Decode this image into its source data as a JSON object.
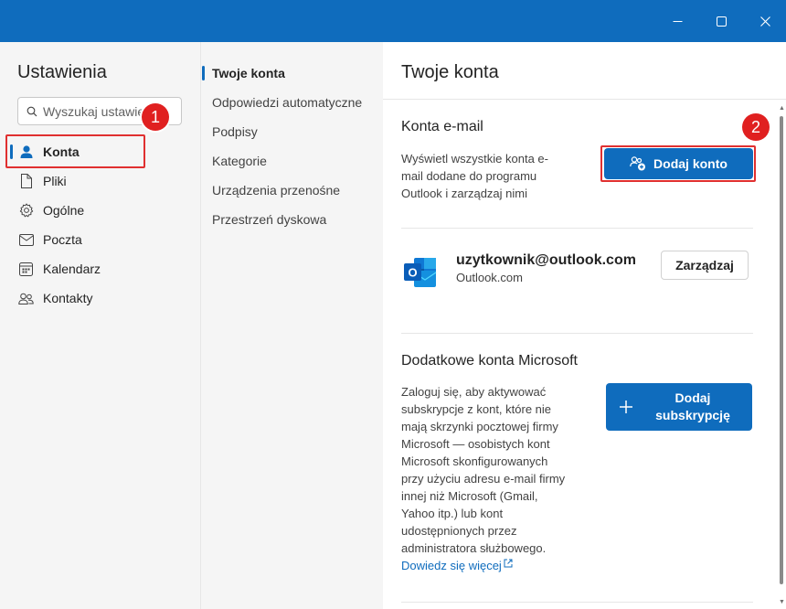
{
  "window": {
    "controls": {
      "minimize_icon": "minimize-icon",
      "maximize_icon": "maximize-icon",
      "close_icon": "close-icon"
    },
    "accent_color": "#0f6cbd"
  },
  "sidebar": {
    "title": "Ustawienia",
    "search": {
      "placeholder": "Wyszukaj ustawienia",
      "value": ""
    },
    "items": [
      {
        "label": "Konta",
        "icon": "person-icon",
        "active": true
      },
      {
        "label": "Pliki",
        "icon": "file-icon"
      },
      {
        "label": "Ogólne",
        "icon": "gear-icon"
      },
      {
        "label": "Poczta",
        "icon": "mail-icon"
      },
      {
        "label": "Kalendarz",
        "icon": "calendar-icon"
      },
      {
        "label": "Kontakty",
        "icon": "people-icon"
      }
    ]
  },
  "subnav": {
    "items": [
      {
        "label": "Twoje konta",
        "active": true
      },
      {
        "label": "Odpowiedzi automatyczne"
      },
      {
        "label": "Podpisy"
      },
      {
        "label": "Kategorie"
      },
      {
        "label": "Urządzenia przenośne"
      },
      {
        "label": "Przestrzeń dyskowa"
      }
    ]
  },
  "main": {
    "title": "Twoje konta",
    "email_section": {
      "title": "Konta e-mail",
      "description_lines": [
        "Wyświetl wszystkie konta e-",
        "mail dodane do programu",
        "Outlook i zarządzaj nimi"
      ],
      "add_button": "Dodaj konto"
    },
    "account": {
      "email": "uzytkownik@outlook.com",
      "type": "Outlook.com",
      "manage_button": "Zarządzaj"
    },
    "microsoft_section": {
      "title": "Dodatkowe konta Microsoft",
      "description_lines": [
        "Zaloguj się, aby aktywować",
        "subskrypcje z kont, które nie",
        "mają skrzynki pocztowej firmy",
        "Microsoft — osobistych kont",
        "Microsoft skonfigurowanych",
        "przy użyciu adresu e-mail firmy",
        "innej niż Microsoft (Gmail,",
        "Yahoo itp.) lub kont",
        "udostępnionych przez",
        "administratora służbowego."
      ],
      "learn_more": "Dowiedz się więcej",
      "add_subscription_lines": [
        "Dodaj",
        "subskrypcję"
      ]
    }
  },
  "annotations": {
    "callout_1": "1",
    "callout_2": "2",
    "highlight_color": "#e03030"
  }
}
